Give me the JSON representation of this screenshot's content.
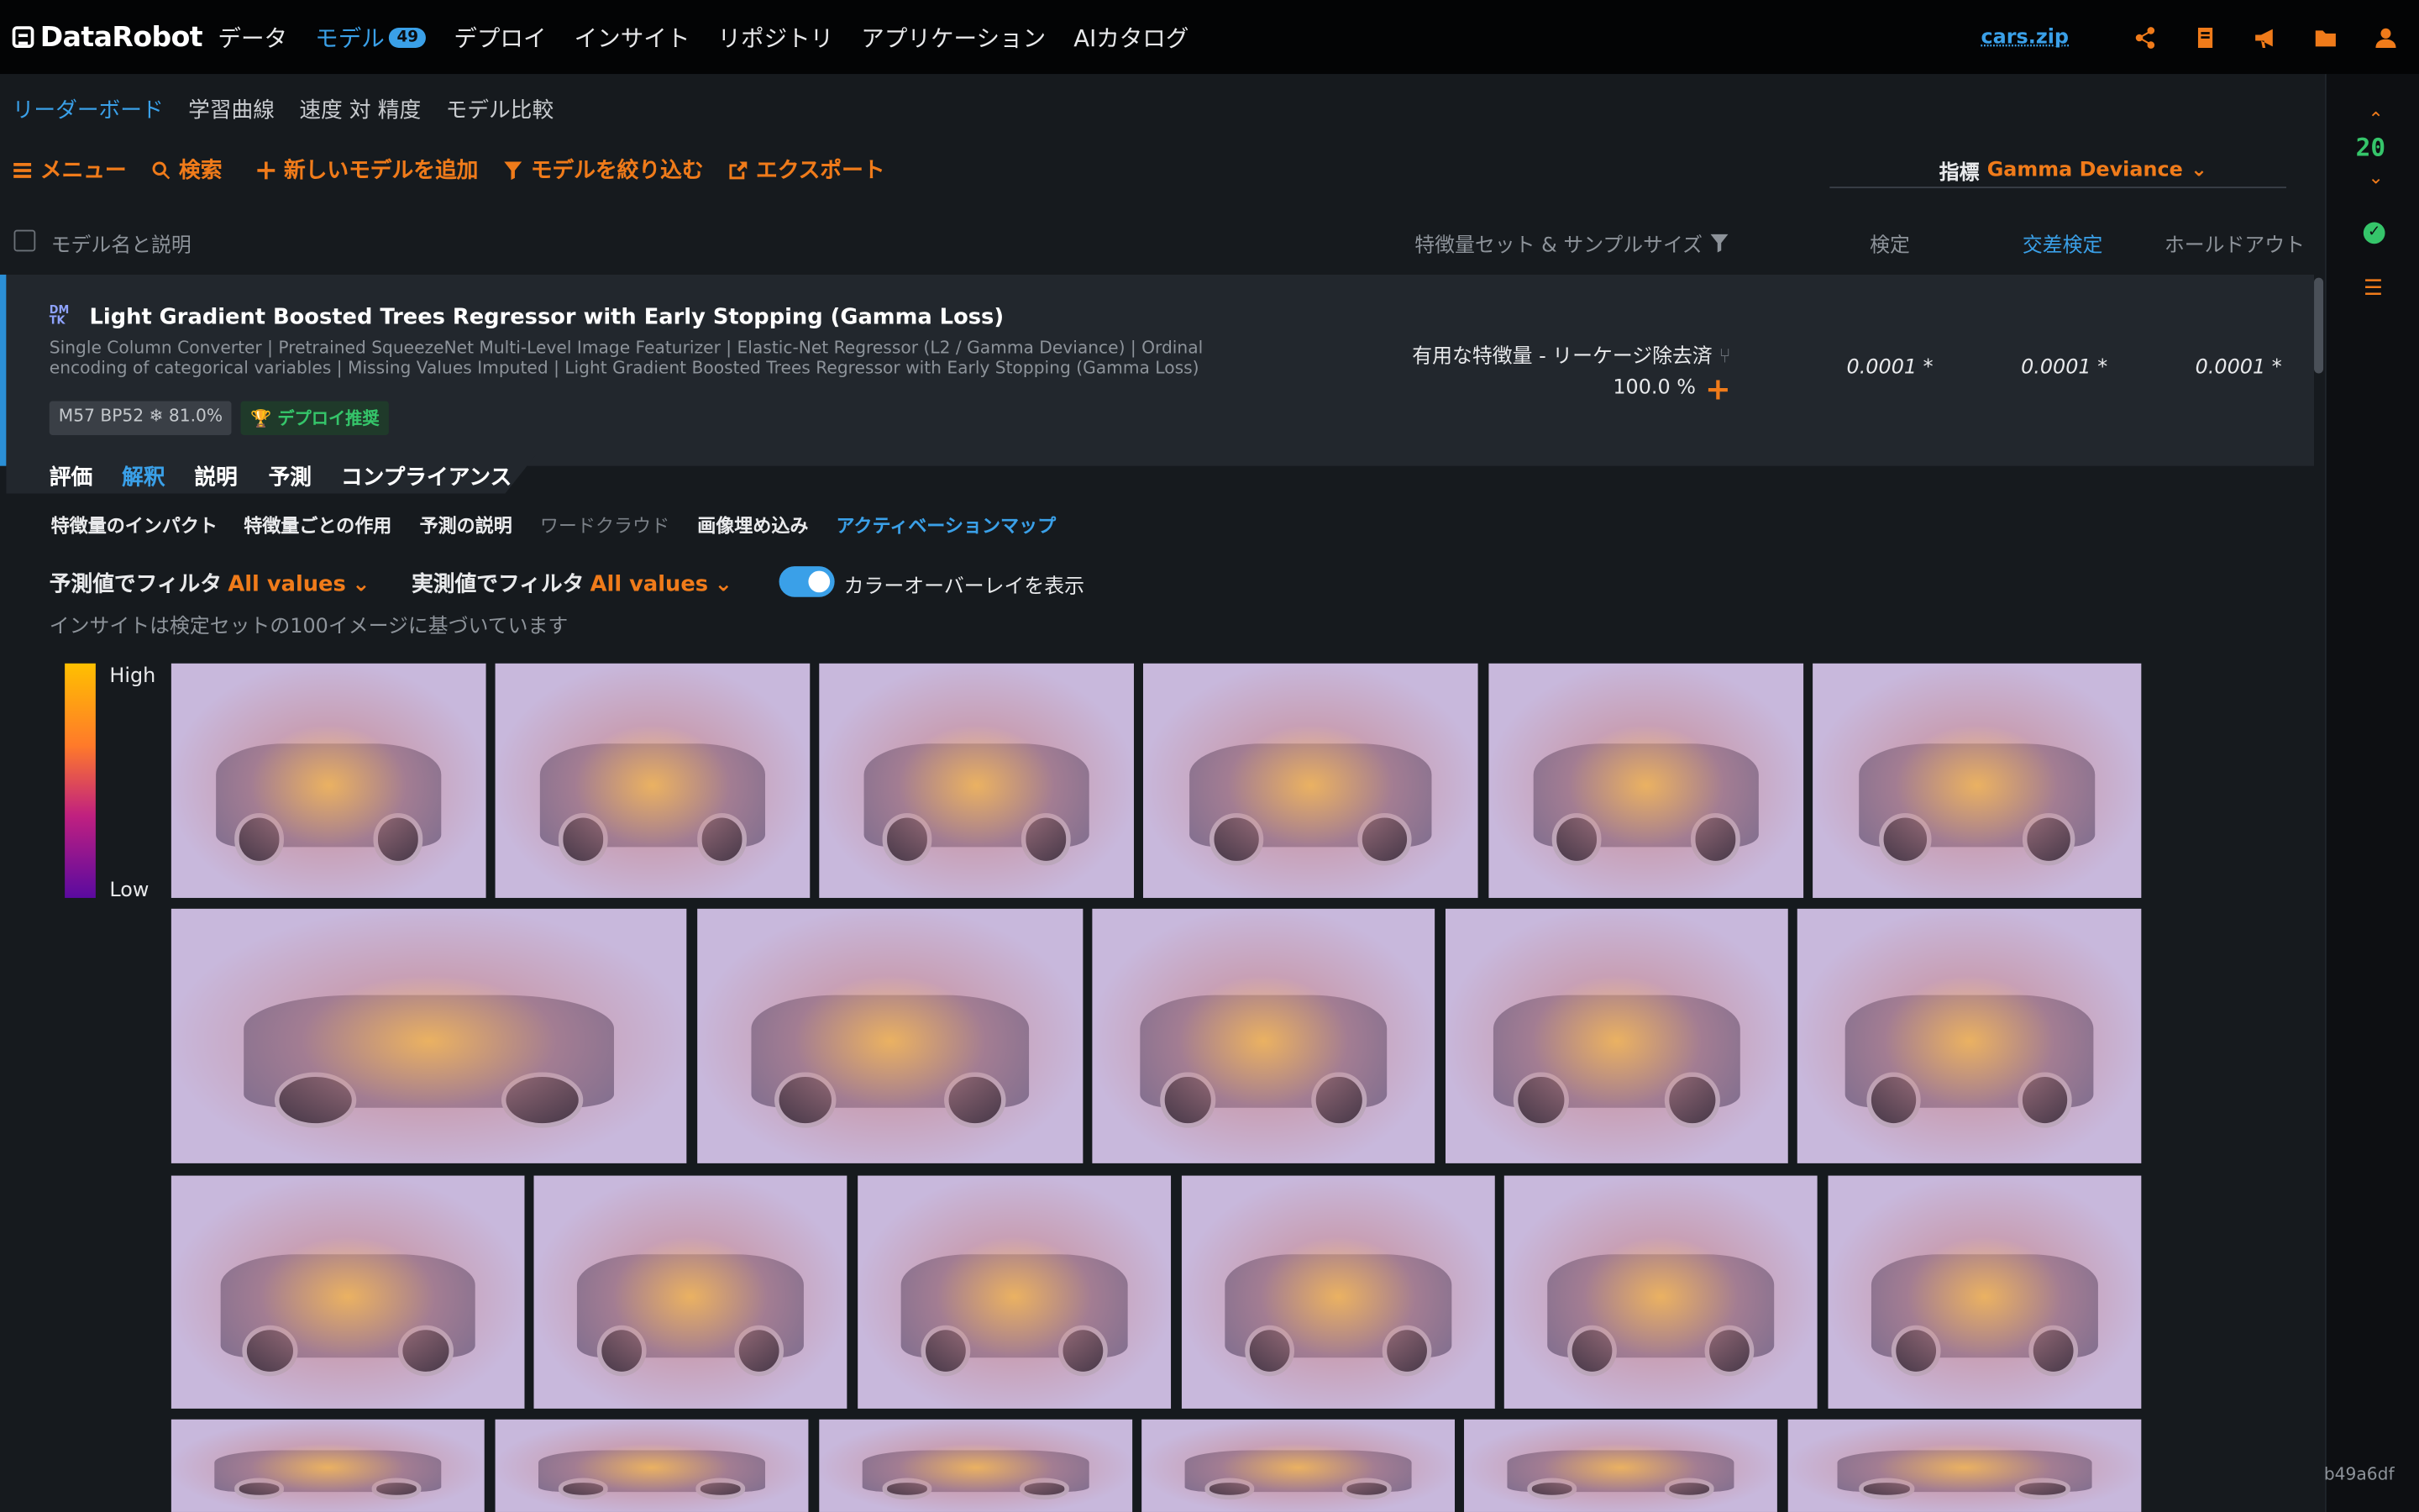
{
  "app": {
    "logo_text": "DataRobot",
    "project": "cars.zip"
  },
  "nav": [
    {
      "label": "データ"
    },
    {
      "label": "モデル",
      "badge": "49"
    },
    {
      "label": "デプロイ"
    },
    {
      "label": "インサイト"
    },
    {
      "label": "リポジトリ"
    },
    {
      "label": "アプリケーション"
    },
    {
      "label": "AIカタログ"
    }
  ],
  "top_icons": [
    "share-icon",
    "book-icon",
    "megaphone-icon",
    "folder-icon",
    "user-icon"
  ],
  "subnav": [
    "リーダーボード",
    "学習曲線",
    "速度 対 精度",
    "モデル比較"
  ],
  "toolbar": {
    "menu": "メニュー",
    "search": "検索",
    "add": "新しいモデルを追加",
    "filter": "モデルを絞り込む",
    "export": "エクスポート"
  },
  "metric": {
    "label": "指標",
    "value": "Gamma Deviance"
  },
  "columns": {
    "name": "モデル名と説明",
    "featureset": "特徴量セット & サンプルサイズ",
    "validation": "検定",
    "cv": "交差検定",
    "holdout": "ホールドアウト"
  },
  "model": {
    "logo": "DM TK",
    "title": "Light Gradient Boosted Trees Regressor with Early Stopping (Gamma Loss)",
    "description": "Single Column Converter | Pretrained SqueezeNet Multi-Level Image Featurizer | Elastic-Net Regressor (L2 / Gamma Deviance) | Ordinal encoding of categorical variables | Missing Values Imputed | Light Gradient Boosted Trees Regressor with Early Stopping (Gamma Loss)",
    "badge_ids": "M57   BP52   ❄ 81.0%",
    "badge_deploy": "デプロイ推奨",
    "featureset": "有用な特徴量 - リーケージ除去済",
    "sample": "100.0 %",
    "scores": {
      "validation": "0.0001 *",
      "cv": "0.0001 *",
      "holdout": "0.0001 *"
    }
  },
  "tabs": [
    "評価",
    "解釈",
    "説明",
    "予測",
    "コンプライアンス"
  ],
  "insight_tabs": [
    "特徴量のインパクト",
    "特徴量ごとの作用",
    "予測の説明",
    "ワードクラウド",
    "画像埋め込み",
    "アクティベーションマップ"
  ],
  "filters": {
    "pred_label": "予測値でフィルタ",
    "pred_value": "All values",
    "actual_label": "実測値でフィルタ",
    "actual_value": "All values",
    "overlay_label": "カラーオーバーレイを表示",
    "overlay_on": true
  },
  "note": "インサイトは検定セットの100イメージに基づいています",
  "legend": {
    "high": "High",
    "low": "Low",
    "colors": [
      "#ffc000",
      "#ff7a2a",
      "#c02080",
      "#5a0aa0"
    ]
  },
  "right_rail": {
    "count": "20"
  },
  "footer_hash": "b49a6df"
}
